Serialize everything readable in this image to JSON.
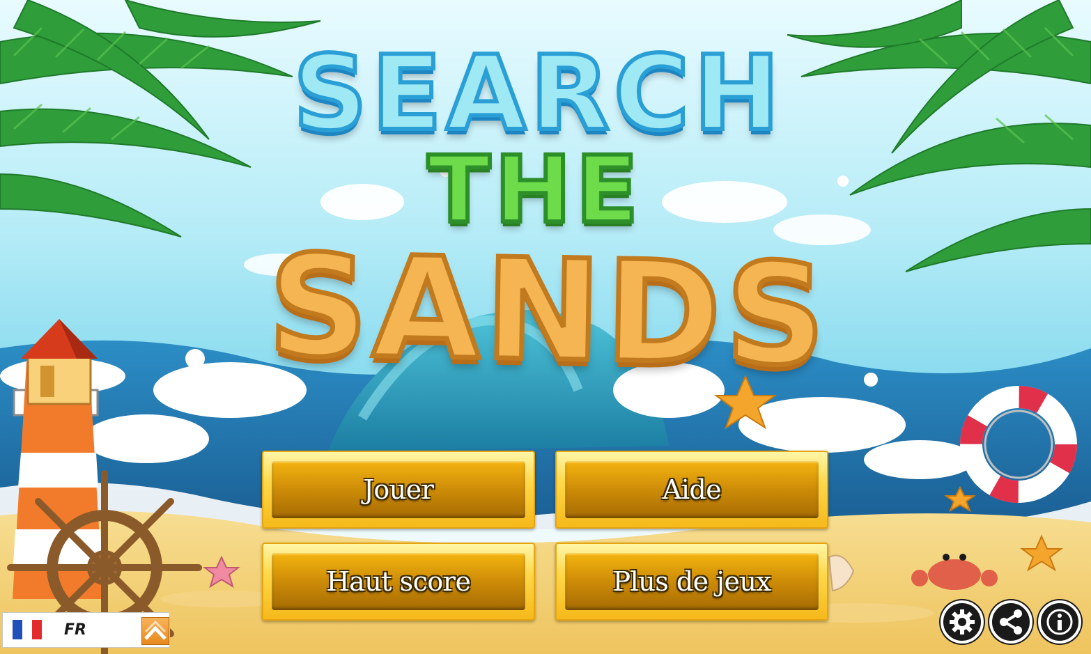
{
  "title": {
    "line1": "SEARCH",
    "line2": "THE",
    "line3": "SANDS"
  },
  "menu": {
    "play": "Jouer",
    "help": "Aide",
    "highscore": "Haut score",
    "more_games": "Plus de jeux"
  },
  "language": {
    "code": "FR",
    "flag_icon": "france-flag-icon",
    "toggle_icon": "chevron-up-icon"
  },
  "corner_buttons": [
    {
      "icon": "gear-icon"
    },
    {
      "icon": "share-icon"
    },
    {
      "icon": "info-icon"
    }
  ],
  "colors": {
    "sky": "#7fd8ee",
    "sea": "#1f7fb8",
    "sand": "#f2d27a",
    "button_gold": "#f5b91a",
    "button_dark": "#a66c04"
  }
}
